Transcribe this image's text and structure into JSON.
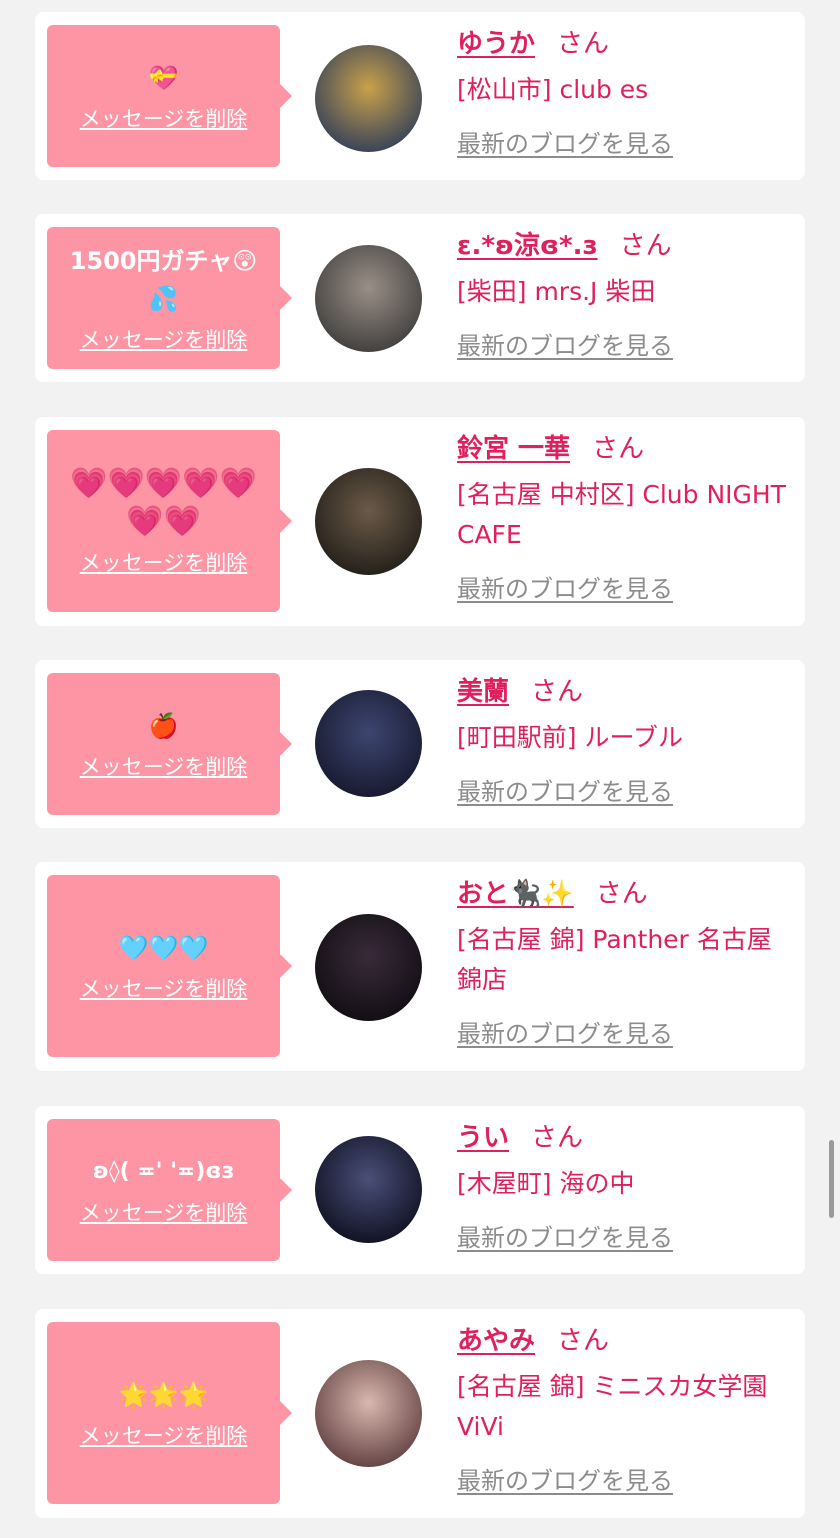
{
  "colors": {
    "accent": "#e0205c",
    "bubble": "#fd95a4",
    "link_gray": "#8c8c8c",
    "background": "#f2f2f2"
  },
  "labels": {
    "delete": "メッセージを削除",
    "san": "さん",
    "blog": "最新のブログを見る"
  },
  "items": [
    {
      "message": "💝",
      "name": "ゆうか",
      "shop": "[松山市] club es",
      "avatar_icon": "avatar-photo",
      "avatar_colors": [
        "#c9a14a",
        "#2b3a5a"
      ]
    },
    {
      "message": "1500円ガチャ😲💦",
      "name": "ε.*ʚ涼ɞ*.з",
      "shop": "[柴田] mrs.J 柴田",
      "avatar_icon": "avatar-photo",
      "avatar_colors": [
        "#9a8f86",
        "#3a3a3a"
      ]
    },
    {
      "message": "💗💗💗💗💗💗💗",
      "name": "鈴宮 一華",
      "shop": "[名古屋 中村区] Club NIGHT CAFE",
      "avatar_icon": "avatar-photo",
      "avatar_colors": [
        "#6b5a48",
        "#1f1b17"
      ]
    },
    {
      "message": "🍎",
      "name": "美蘭",
      "shop": "[町田駅前] ルーブル",
      "avatar_icon": "avatar-photo",
      "avatar_colors": [
        "#3d4670",
        "#14162a"
      ]
    },
    {
      "message": "🩵🩵🩵",
      "name": "おと🐈‍⬛✨",
      "shop": "[名古屋 錦] Panther 名古屋錦店",
      "avatar_icon": "avatar-photo",
      "avatar_colors": [
        "#3a2a3a",
        "#0e0c10"
      ]
    },
    {
      "message": "ʚ◊( ≖' '≖)ɞз",
      "name": "うい",
      "shop": "[木屋町] 海の中",
      "avatar_icon": "avatar-photo",
      "avatar_colors": [
        "#4a4f78",
        "#0b0d1c"
      ]
    },
    {
      "message": "🌟🌟🌟",
      "name": "あやみ",
      "shop": "[名古屋 錦] ミニスカ女学園ViVi",
      "avatar_icon": "avatar-photo",
      "avatar_colors": [
        "#d9b8b0",
        "#5a3a3a"
      ]
    }
  ]
}
